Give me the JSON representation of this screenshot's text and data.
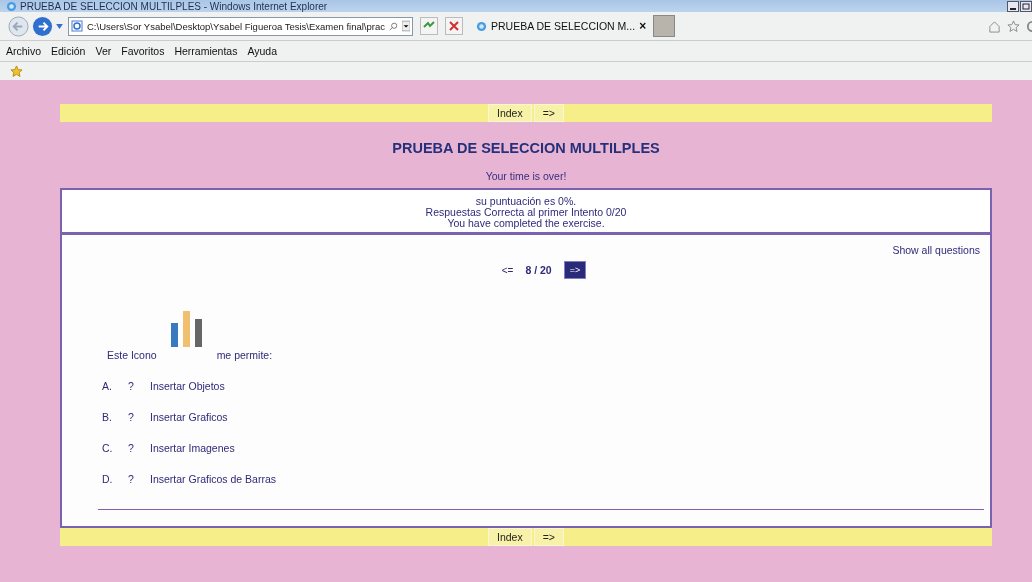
{
  "window": {
    "title": "PRUEBA DE SELECCION MULTILPLES - Windows Internet Explorer"
  },
  "address_bar": {
    "value": "C:\\Users\\Sor Ysabel\\Desktop\\Ysabel Figueroa Tesis\\Examen final\\prac"
  },
  "tab": {
    "label": "PRUEBA DE SELECCION M...",
    "close": "×"
  },
  "menu": [
    "Archivo",
    "Edición",
    "Ver",
    "Favoritos",
    "Herramientas",
    "Ayuda"
  ],
  "top_nav": {
    "index": "Index",
    "next": "=>"
  },
  "heading": "PRUEBA DE SELECCION MULTILPLES",
  "time_message": "Your time is over!",
  "score": [
    "su puntuación es 0%.",
    "Respuestas Correcta al primer Intento 0/20",
    "You have completed the exercise."
  ],
  "show_all": "Show all questions",
  "pager": {
    "prev": "<=",
    "position": "8 / 20",
    "next": "=>"
  },
  "question": {
    "before_icon": "Este Icono",
    "after_icon": "me permite:"
  },
  "answers": [
    {
      "letter": "A.",
      "mark": "?",
      "text": "Insertar Objetos"
    },
    {
      "letter": "B.",
      "mark": "?",
      "text": "Insertar Graficos"
    },
    {
      "letter": "C.",
      "mark": "?",
      "text": "Insertar Imagenes"
    },
    {
      "letter": "D.",
      "mark": "?",
      "text": "Insertar Graficos de Barras"
    }
  ],
  "bottom_nav": {
    "index": "Index",
    "next": "=>"
  }
}
